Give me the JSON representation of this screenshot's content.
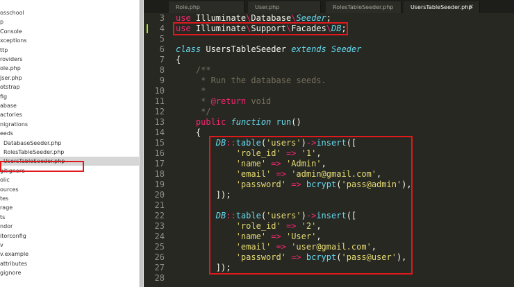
{
  "sidebar": {
    "items": [
      {
        "label": "osschool",
        "indent": 0
      },
      {
        "label": "p",
        "indent": 0
      },
      {
        "label": "Console",
        "indent": 0
      },
      {
        "label": "xceptions",
        "indent": 0
      },
      {
        "label": "ttp",
        "indent": 0
      },
      {
        "label": "roviders",
        "indent": 0
      },
      {
        "label": "ole.php",
        "indent": 0
      },
      {
        "label": "Jser.php",
        "indent": 0
      },
      {
        "label": "otstrap",
        "indent": 0
      },
      {
        "label": "fig",
        "indent": 0
      },
      {
        "label": "abase",
        "indent": 0
      },
      {
        "label": "actories",
        "indent": 0
      },
      {
        "label": "nigrations",
        "indent": 0
      },
      {
        "label": "eeds",
        "indent": 0
      },
      {
        "label": "DatabaseSeeder.php",
        "indent": 1
      },
      {
        "label": "RolesTableSeeder.php",
        "indent": 1
      },
      {
        "label": "UsersTableSeeder.php",
        "indent": 1,
        "selected": true
      },
      {
        "label": "gitignore",
        "indent": 0
      },
      {
        "label": "olic",
        "indent": 0
      },
      {
        "label": "ources",
        "indent": 0
      },
      {
        "label": "tes",
        "indent": 0
      },
      {
        "label": "rage",
        "indent": 0
      },
      {
        "label": "ts",
        "indent": 0
      },
      {
        "label": "ndor",
        "indent": 0
      },
      {
        "label": "itorconfig",
        "indent": 0
      },
      {
        "label": "v",
        "indent": 0
      },
      {
        "label": "v.example",
        "indent": 0
      },
      {
        "label": "attributes",
        "indent": 0
      },
      {
        "label": "gignore",
        "indent": 0
      }
    ]
  },
  "tabs": [
    {
      "label": "Role.php",
      "active": false
    },
    {
      "label": "User.php",
      "active": false
    },
    {
      "label": "RolesTableSeeder.php",
      "active": false
    },
    {
      "label": "UsersTableSeeder.php",
      "active": true
    }
  ],
  "tab_close_glyph": "×",
  "colors": {
    "accent_highlight": "#e0191d",
    "keyword": "#f92672",
    "string": "#e6db74",
    "type": "#66d9ef",
    "comment": "#75715e",
    "background": "#272822"
  },
  "editor": {
    "lines": [
      {
        "n": "3",
        "tokens": [
          [
            "k",
            "use"
          ],
          [
            "p",
            " Illuminate"
          ],
          [
            "sl",
            "\\"
          ],
          [
            "p",
            "Database"
          ],
          [
            "sl",
            "\\"
          ],
          [
            "t",
            "Seeder"
          ],
          [
            "p",
            ";"
          ]
        ]
      },
      {
        "n": "4",
        "tokens": [
          [
            "k",
            "use"
          ],
          [
            "p",
            " Illuminate"
          ],
          [
            "sl",
            "\\"
          ],
          [
            "p",
            "Support"
          ],
          [
            "sl",
            "\\"
          ],
          [
            "p",
            "Facades"
          ],
          [
            "sl",
            "\\"
          ],
          [
            "t",
            "DB"
          ],
          [
            "p",
            ";"
          ]
        ]
      },
      {
        "n": "5",
        "tokens": []
      },
      {
        "n": "6",
        "tokens": [
          [
            "t",
            "class"
          ],
          [
            "p",
            " "
          ],
          [
            "p",
            "UsersTableSeeder"
          ],
          [
            "p",
            " "
          ],
          [
            "t",
            "extends"
          ],
          [
            "p",
            " "
          ],
          [
            "t",
            "Seeder"
          ]
        ]
      },
      {
        "n": "7",
        "tokens": [
          [
            "p",
            "{"
          ]
        ]
      },
      {
        "n": "8",
        "tokens": [
          [
            "c",
            "    /**"
          ]
        ]
      },
      {
        "n": "9",
        "tokens": [
          [
            "c",
            "     * Run the database seeds."
          ]
        ]
      },
      {
        "n": "10",
        "tokens": [
          [
            "c",
            "     *"
          ]
        ]
      },
      {
        "n": "11",
        "tokens": [
          [
            "c",
            "     * "
          ],
          [
            "k",
            "@return"
          ],
          [
            "c",
            " void"
          ]
        ]
      },
      {
        "n": "12",
        "tokens": [
          [
            "c",
            "     */"
          ]
        ]
      },
      {
        "n": "13",
        "tokens": [
          [
            "p",
            "    "
          ],
          [
            "k",
            "public"
          ],
          [
            "p",
            " "
          ],
          [
            "t",
            "function"
          ],
          [
            "p",
            " "
          ],
          [
            "fn",
            "run"
          ],
          [
            "p",
            "()"
          ]
        ]
      },
      {
        "n": "14",
        "tokens": [
          [
            "p",
            "    {"
          ]
        ]
      },
      {
        "n": "15",
        "tokens": [
          [
            "p",
            "        "
          ],
          [
            "t",
            "DB"
          ],
          [
            "k",
            "::"
          ],
          [
            "fn",
            "table"
          ],
          [
            "p",
            "("
          ],
          [
            "s",
            "'users'"
          ],
          [
            "p",
            ")"
          ],
          [
            "k",
            "->"
          ],
          [
            "fn",
            "insert"
          ],
          [
            "p",
            "(["
          ]
        ]
      },
      {
        "n": "16",
        "tokens": [
          [
            "p",
            "            "
          ],
          [
            "s",
            "'role_id'"
          ],
          [
            "p",
            " "
          ],
          [
            "k",
            "=>"
          ],
          [
            "p",
            " "
          ],
          [
            "s",
            "'1'"
          ],
          [
            "p",
            ","
          ]
        ]
      },
      {
        "n": "17",
        "tokens": [
          [
            "p",
            "            "
          ],
          [
            "s",
            "'name'"
          ],
          [
            "p",
            " "
          ],
          [
            "k",
            "=>"
          ],
          [
            "p",
            " "
          ],
          [
            "s",
            "'Admin'"
          ],
          [
            "p",
            ","
          ]
        ]
      },
      {
        "n": "18",
        "tokens": [
          [
            "p",
            "            "
          ],
          [
            "s",
            "'email'"
          ],
          [
            "p",
            " "
          ],
          [
            "k",
            "=>"
          ],
          [
            "p",
            " "
          ],
          [
            "s",
            "'admin@gmail.com'"
          ],
          [
            "p",
            ","
          ]
        ]
      },
      {
        "n": "19",
        "tokens": [
          [
            "p",
            "            "
          ],
          [
            "s",
            "'password'"
          ],
          [
            "p",
            " "
          ],
          [
            "k",
            "=>"
          ],
          [
            "p",
            " "
          ],
          [
            "fn",
            "bcrypt"
          ],
          [
            "p",
            "("
          ],
          [
            "s",
            "'pass@admin'"
          ],
          [
            "p",
            "),"
          ]
        ]
      },
      {
        "n": "20",
        "tokens": [
          [
            "p",
            "        ]);"
          ]
        ]
      },
      {
        "n": "21",
        "tokens": []
      },
      {
        "n": "22",
        "tokens": [
          [
            "p",
            "        "
          ],
          [
            "t",
            "DB"
          ],
          [
            "k",
            "::"
          ],
          [
            "fn",
            "table"
          ],
          [
            "p",
            "("
          ],
          [
            "s",
            "'users'"
          ],
          [
            "p",
            ")"
          ],
          [
            "k",
            "->"
          ],
          [
            "fn",
            "insert"
          ],
          [
            "p",
            "(["
          ]
        ]
      },
      {
        "n": "23",
        "tokens": [
          [
            "p",
            "            "
          ],
          [
            "s",
            "'role_id'"
          ],
          [
            "p",
            " "
          ],
          [
            "k",
            "=>"
          ],
          [
            "p",
            " "
          ],
          [
            "s",
            "'2'"
          ],
          [
            "p",
            ","
          ]
        ]
      },
      {
        "n": "24",
        "tokens": [
          [
            "p",
            "            "
          ],
          [
            "s",
            "'name'"
          ],
          [
            "p",
            " "
          ],
          [
            "k",
            "=>"
          ],
          [
            "p",
            " "
          ],
          [
            "s",
            "'User'"
          ],
          [
            "p",
            ","
          ]
        ]
      },
      {
        "n": "25",
        "tokens": [
          [
            "p",
            "            "
          ],
          [
            "s",
            "'email'"
          ],
          [
            "p",
            " "
          ],
          [
            "k",
            "=>"
          ],
          [
            "p",
            " "
          ],
          [
            "s",
            "'user@gmail.com'"
          ],
          [
            "p",
            ","
          ]
        ]
      },
      {
        "n": "26",
        "tokens": [
          [
            "p",
            "            "
          ],
          [
            "s",
            "'password'"
          ],
          [
            "p",
            " "
          ],
          [
            "k",
            "=>"
          ],
          [
            "p",
            " "
          ],
          [
            "fn",
            "bcrypt"
          ],
          [
            "p",
            "("
          ],
          [
            "s",
            "'pass@user'"
          ],
          [
            "p",
            "),"
          ]
        ]
      },
      {
        "n": "27",
        "tokens": [
          [
            "p",
            "        ]);"
          ]
        ]
      },
      {
        "n": "28",
        "tokens": []
      }
    ]
  }
}
